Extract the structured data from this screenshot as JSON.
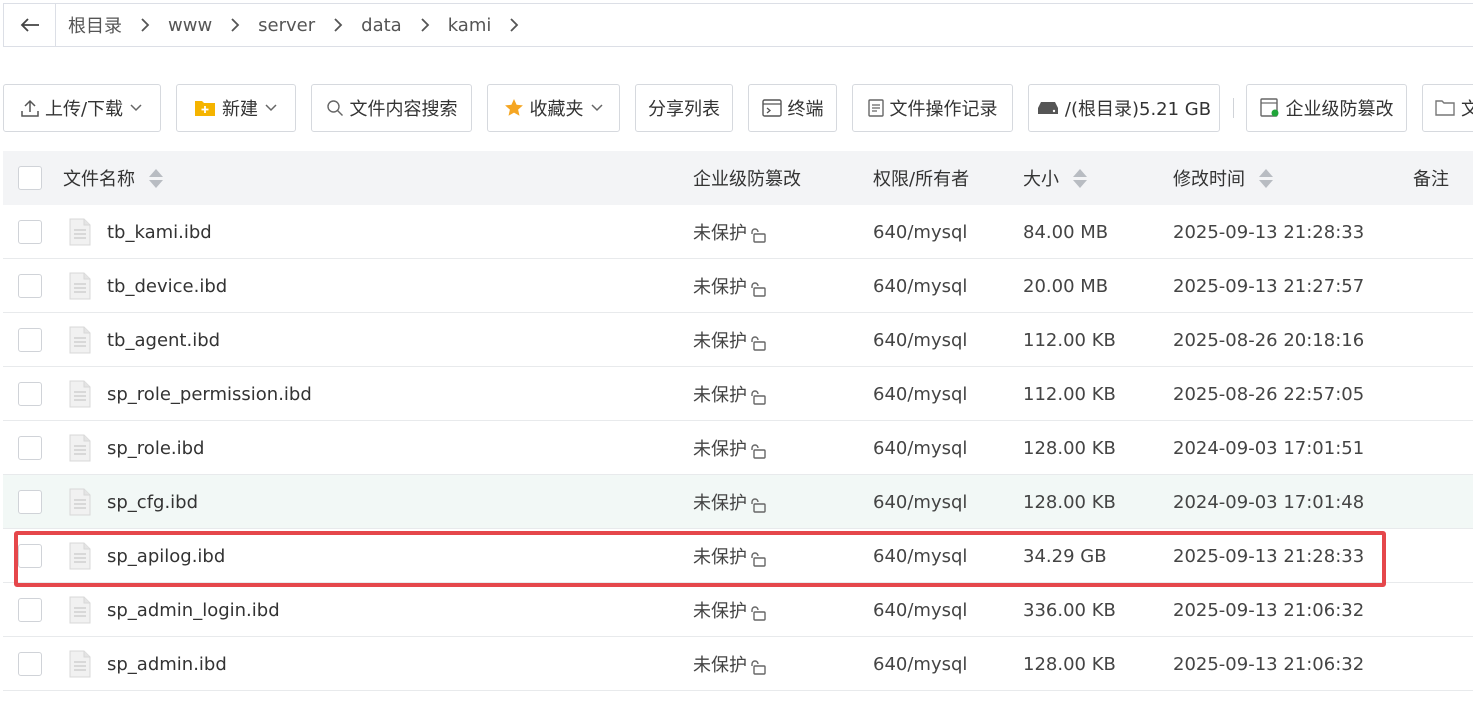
{
  "breadcrumb": {
    "back_label": "←",
    "items": [
      "根目录",
      "www",
      "server",
      "data",
      "kami"
    ]
  },
  "toolbar": {
    "upload_download": "上传/下载",
    "new": "新建",
    "content_search": "文件内容搜索",
    "favorites": "收藏夹",
    "share_list": "分享列表",
    "terminal": "终端",
    "file_op_log": "文件操作记录",
    "disk": "/(根目录)5.21 GB",
    "tamper_proof": "企业级防篡改",
    "more": "文"
  },
  "table": {
    "headers": {
      "name": "文件名称",
      "tamper": "企业级防篡改",
      "perm": "权限/所有者",
      "size": "大小",
      "mtime": "修改时间",
      "note": "备注"
    },
    "rows": [
      {
        "name": "tb_kami.ibd",
        "tamper": "未保护",
        "perm": "640/mysql",
        "size": "84.00 MB",
        "mtime": "2025-09-13 21:28:33"
      },
      {
        "name": "tb_device.ibd",
        "tamper": "未保护",
        "perm": "640/mysql",
        "size": "20.00 MB",
        "mtime": "2025-09-13 21:27:57"
      },
      {
        "name": "tb_agent.ibd",
        "tamper": "未保护",
        "perm": "640/mysql",
        "size": "112.00 KB",
        "mtime": "2025-08-26 20:18:16"
      },
      {
        "name": "sp_role_permission.ibd",
        "tamper": "未保护",
        "perm": "640/mysql",
        "size": "112.00 KB",
        "mtime": "2025-08-26 22:57:05"
      },
      {
        "name": "sp_role.ibd",
        "tamper": "未保护",
        "perm": "640/mysql",
        "size": "128.00 KB",
        "mtime": "2024-09-03 17:01:51"
      },
      {
        "name": "sp_cfg.ibd",
        "tamper": "未保护",
        "perm": "640/mysql",
        "size": "128.00 KB",
        "mtime": "2024-09-03 17:01:48"
      },
      {
        "name": "sp_apilog.ibd",
        "tamper": "未保护",
        "perm": "640/mysql",
        "size": "34.29 GB",
        "mtime": "2025-09-13 21:28:33"
      },
      {
        "name": "sp_admin_login.ibd",
        "tamper": "未保护",
        "perm": "640/mysql",
        "size": "336.00 KB",
        "mtime": "2025-09-13 21:06:32"
      },
      {
        "name": "sp_admin.ibd",
        "tamper": "未保护",
        "perm": "640/mysql",
        "size": "128.00 KB",
        "mtime": "2025-09-13 21:06:32"
      }
    ]
  },
  "colors": {
    "highlight": "#e5474b",
    "star": "#f5a623",
    "folder": "#f5b400",
    "hover_row": "#f2f8f6"
  }
}
